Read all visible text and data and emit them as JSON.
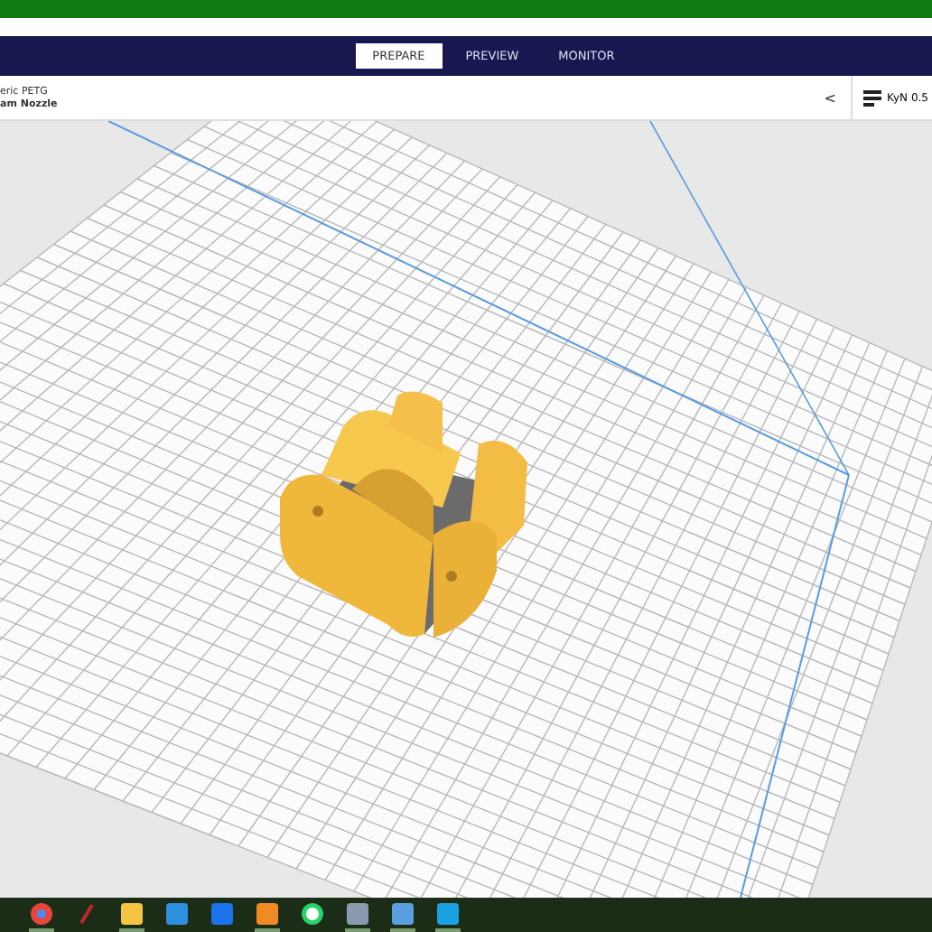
{
  "stages": [
    {
      "label": "PREPARE",
      "selected": true
    },
    {
      "label": "PREVIEW",
      "selected": false
    },
    {
      "label": "MONITOR",
      "selected": false
    }
  ],
  "material": {
    "line_1": "eric PETG",
    "line_2": "am Nozzle"
  },
  "collapse": "<",
  "printer": "KyN 0.5",
  "taskbar": [
    {
      "kind": "chrome",
      "open": true
    },
    {
      "kind": "pen",
      "open": false
    },
    {
      "kind": "folder",
      "open": true
    },
    {
      "kind": "mail",
      "open": false
    },
    {
      "kind": "remote",
      "open": false
    },
    {
      "kind": "f-app",
      "open": true
    },
    {
      "kind": "chat",
      "open": false
    },
    {
      "kind": "calculator",
      "open": true
    },
    {
      "kind": "photos",
      "open": true
    },
    {
      "kind": "cura",
      "open": true
    }
  ]
}
